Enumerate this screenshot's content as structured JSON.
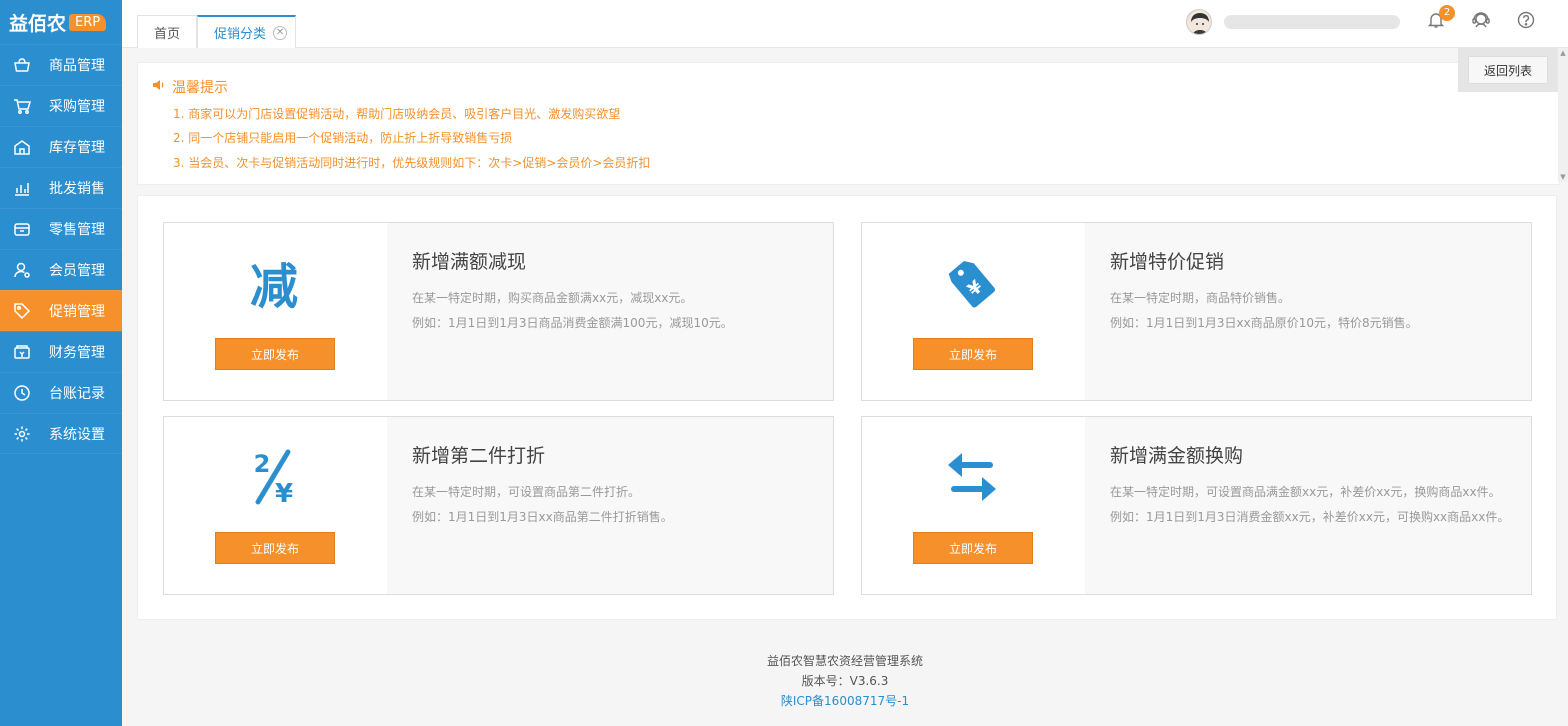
{
  "app": {
    "logo_text": "益佰农",
    "logo_badge": "ERP"
  },
  "sidebar": {
    "items": [
      {
        "label": "商品管理",
        "icon": "basket-icon"
      },
      {
        "label": "采购管理",
        "icon": "cart-icon"
      },
      {
        "label": "库存管理",
        "icon": "warehouse-icon"
      },
      {
        "label": "批发销售",
        "icon": "chart-icon"
      },
      {
        "label": "零售管理",
        "icon": "store-icon"
      },
      {
        "label": "会员管理",
        "icon": "member-icon"
      },
      {
        "label": "促销管理",
        "icon": "tag-icon",
        "active": true
      },
      {
        "label": "财务管理",
        "icon": "finance-icon"
      },
      {
        "label": "台账记录",
        "icon": "clock-icon"
      },
      {
        "label": "系统设置",
        "icon": "gear-icon"
      }
    ]
  },
  "tabs": [
    {
      "label": "首页"
    },
    {
      "label": "促销分类",
      "active": true
    }
  ],
  "header": {
    "notification_count": "2"
  },
  "notice": {
    "title": "温馨提示",
    "lines": [
      "1. 商家可以为门店设置促销活动，帮助门店吸纳会员、吸引客户目光、激发购买欲望",
      "2. 同一个店铺只能启用一个促销活动，防止折上折导致销售亏损",
      "3. 当会员、次卡与促销活动同时进行时，优先级规则如下：次卡>促销>会员价>会员折扣"
    ],
    "back_label": "返回列表"
  },
  "cards": [
    {
      "title": "新增满额减现",
      "desc1": "在某一特定时期，购买商品金额满xx元，减现xx元。",
      "desc2": "例如：1月1日到1月3日商品消费金额满100元，减现10元。",
      "button": "立即发布",
      "icon": "reduce-icon"
    },
    {
      "title": "新增特价促销",
      "desc1": "在某一特定时期，商品特价销售。",
      "desc2": "例如：1月1日到1月3日xx商品原价10元，特价8元销售。",
      "button": "立即发布",
      "icon": "price-tag-icon"
    },
    {
      "title": "新增第二件打折",
      "desc1": "在某一特定时期，可设置商品第二件打折。",
      "desc2": "例如：1月1日到1月3日xx商品第二件打折销售。",
      "button": "立即发布",
      "icon": "discount-icon"
    },
    {
      "title": "新增满金额换购",
      "desc1": "在某一特定时期，可设置商品满金额xx元，补差价xx元，换购商品xx件。",
      "desc2": "例如：1月1日到1月3日消费金额xx元，补差价xx元，可换购xx商品xx件。",
      "button": "立即发布",
      "icon": "exchange-icon"
    }
  ],
  "footer": {
    "system_name": "益佰农智慧农资经营管理系统",
    "version": "版本号：V3.6.3",
    "icp": "陕ICP备16008717号-1"
  },
  "colors": {
    "primary": "#2a8ecf",
    "accent": "#f5902a"
  }
}
